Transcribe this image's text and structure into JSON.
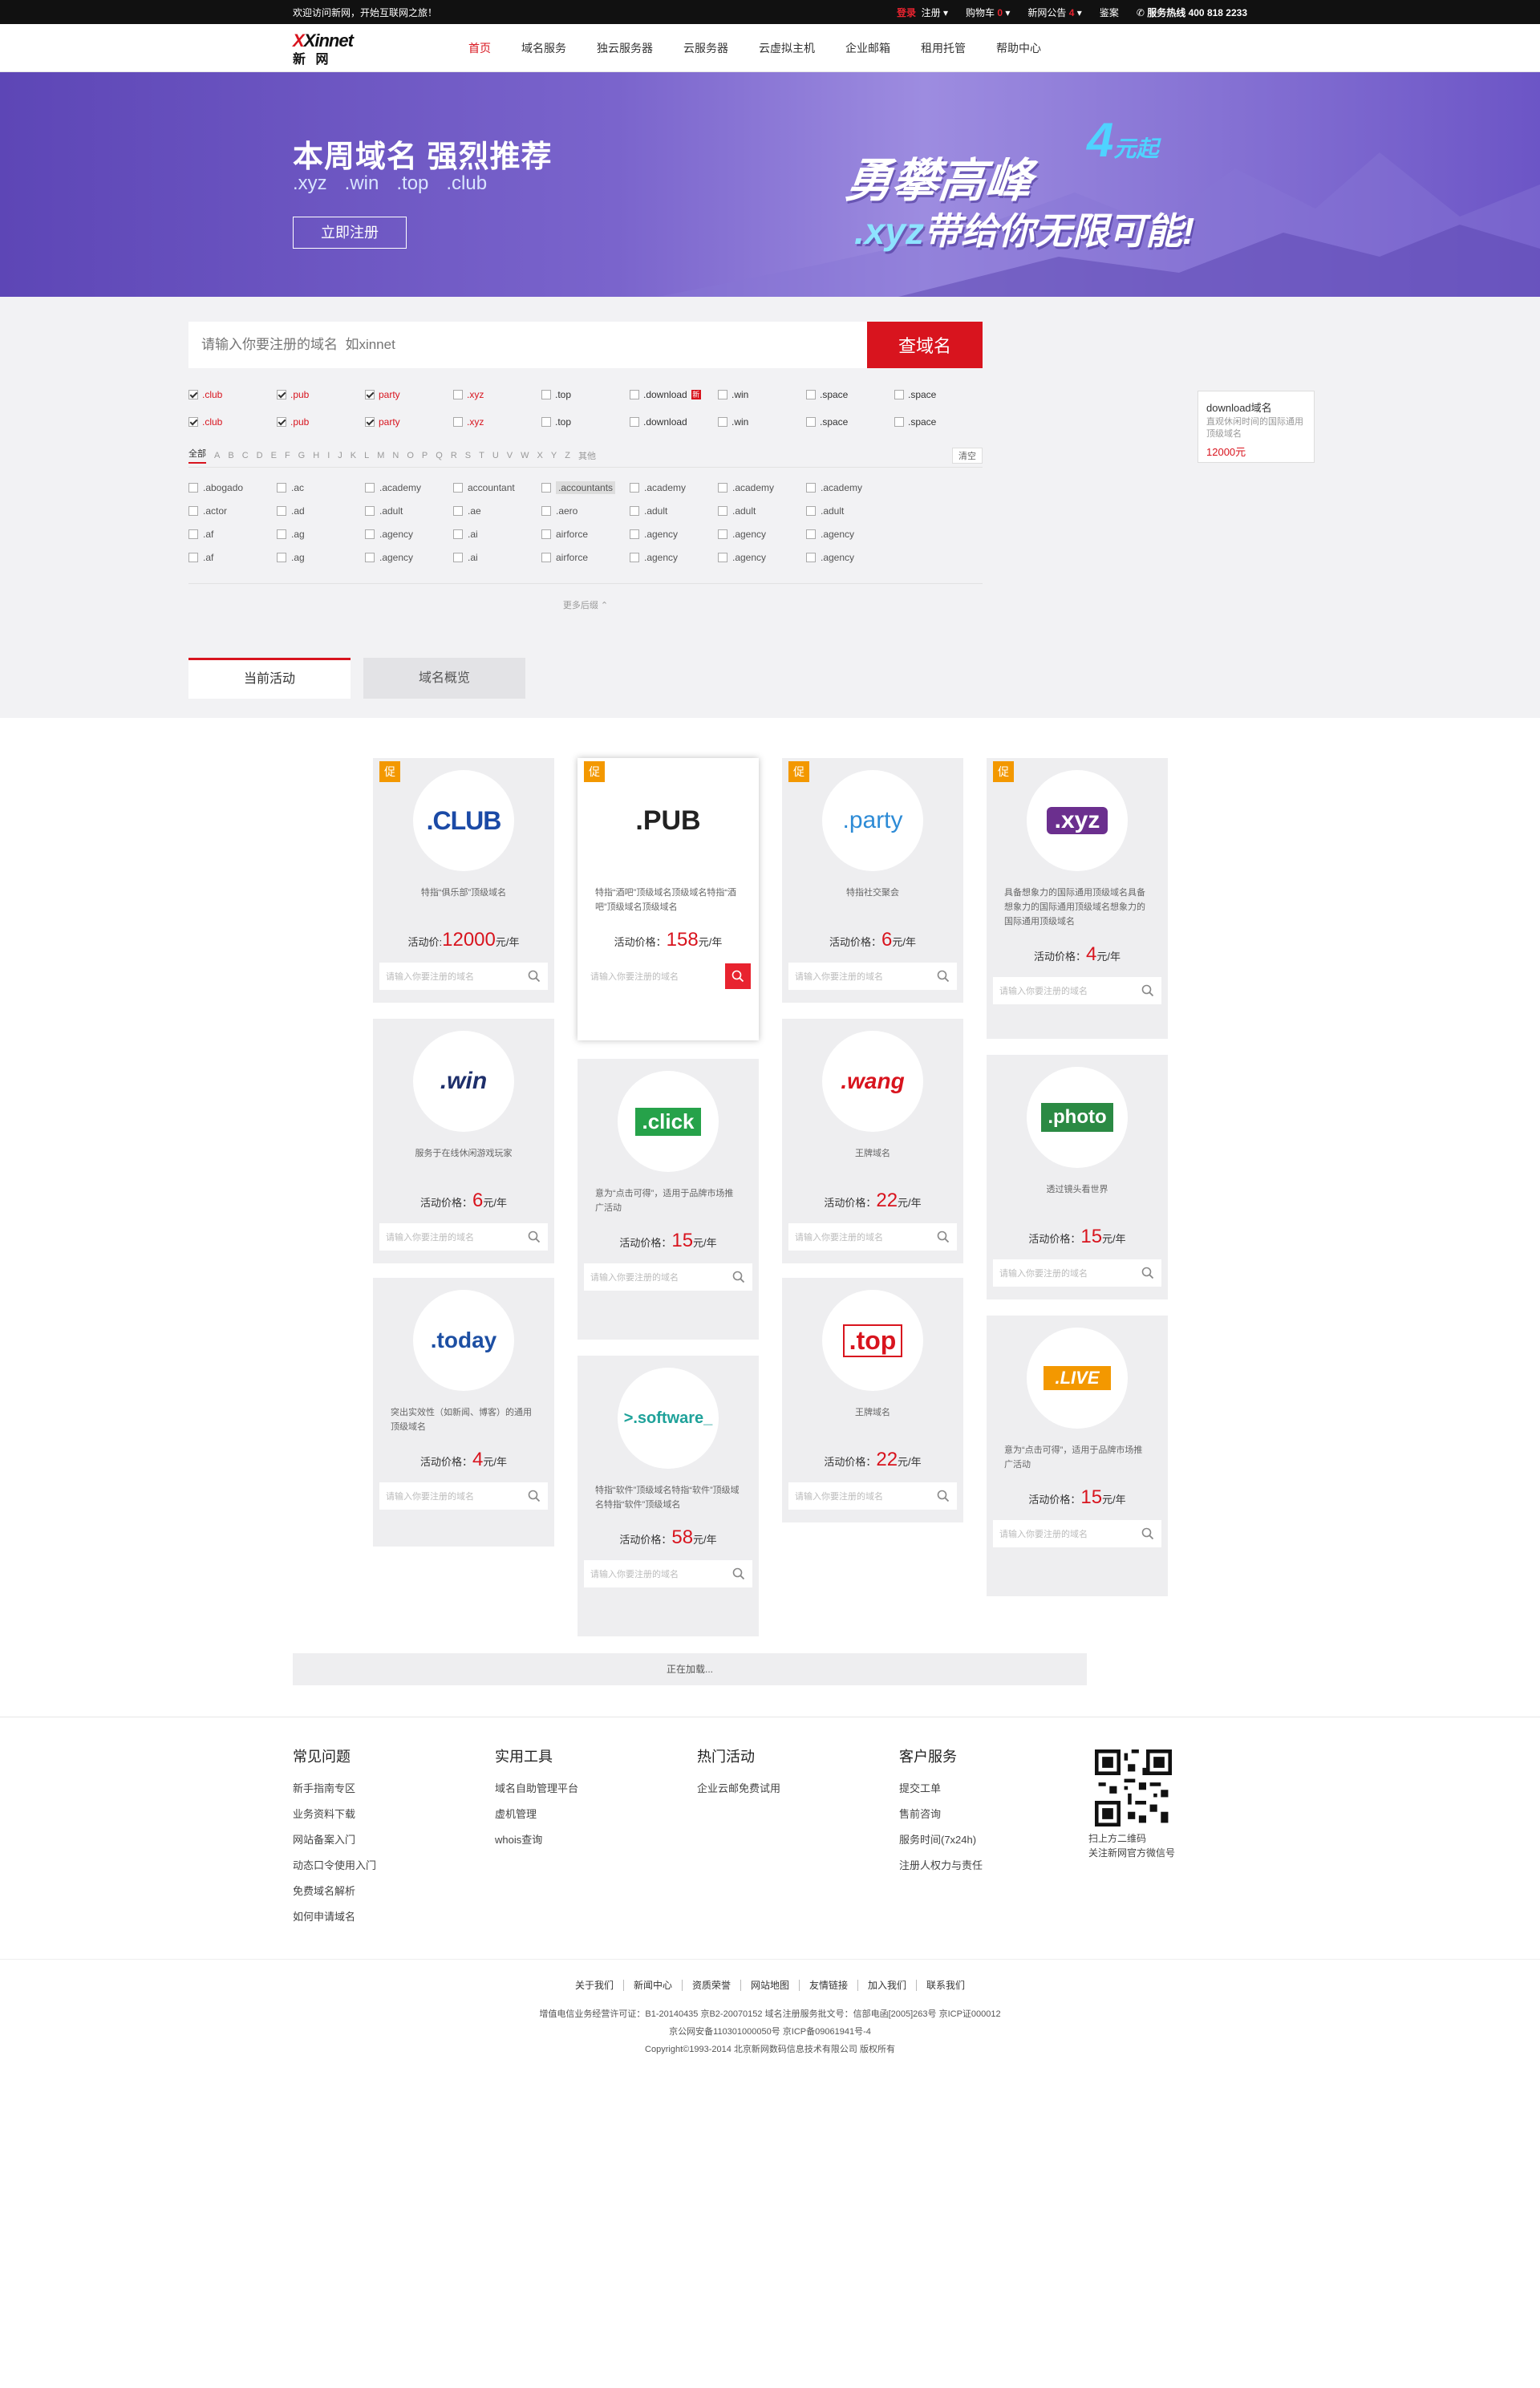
{
  "topbar": {
    "welcome": "欢迎访问新网，开始互联网之旅！",
    "login": "登录",
    "register": "注册",
    "cart": "购物车",
    "cart_count": "0",
    "notice": "新网公告",
    "notice_count": "4",
    "feedback": "鉴案",
    "hotline": "服务热线 400 818 2233"
  },
  "logo": {
    "en": "Xinnet",
    "cn": "新 网"
  },
  "nav": [
    "首页",
    "域名服务",
    "独云服务器",
    "云服务器",
    "云虚拟主机",
    "企业邮箱",
    "租用托管",
    "帮助中心"
  ],
  "banner": {
    "title": "本周域名 强烈推荐",
    "tlds": [
      ".xyz",
      ".win",
      ".top",
      ".club"
    ],
    "button": "立即注册",
    "slogan": "勇攀高峰",
    "four": "4",
    "yuan": "元起",
    "slogan2_a": ".xyz",
    "slogan2_b": "带给你无限可能!"
  },
  "search": {
    "placeholder": "请输入你要注册的域名  如xinnet",
    "button": "查域名"
  },
  "tld_rows": [
    [
      ".club",
      ".pub",
      "party",
      ".xyz",
      ".top",
      ".download",
      ".win",
      ".space",
      ".space"
    ],
    [
      ".club",
      ".pub",
      "party",
      ".xyz",
      ".top",
      ".download",
      ".win",
      ".space",
      ".space"
    ]
  ],
  "tip": {
    "title": "download域名",
    "desc": "直观休闲时间的国际通用顶级域名",
    "price": "12000元"
  },
  "alpha": {
    "all": "全部",
    "letters": [
      "A",
      "B",
      "C",
      "D",
      "E",
      "F",
      "G",
      "H",
      "I",
      "J",
      "K",
      "L",
      "M",
      "N",
      "O",
      "P",
      "Q",
      "R",
      "S",
      "T",
      "U",
      "V",
      "W",
      "X",
      "Y",
      "Z"
    ],
    "other": "其他",
    "clear": "清空"
  },
  "ext_rows": [
    [
      ".abogado",
      ".ac",
      ".academy",
      "accountant",
      ".accountants",
      ".academy",
      ".academy",
      ".academy"
    ],
    [
      ".actor",
      ".ad",
      ".adult",
      ".ae",
      ".aero",
      ".adult",
      ".adult",
      ".adult"
    ],
    [
      ".af",
      ".ag",
      ".agency",
      ".ai",
      "airforce",
      ".agency",
      ".agency",
      ".agency"
    ],
    [
      ".af",
      ".ag",
      ".agency",
      ".ai",
      "airforce",
      ".agency",
      ".agency",
      ".agency"
    ]
  ],
  "more": "更多后缀",
  "tabs": [
    "当前活动",
    "域名概览"
  ],
  "promo_label": "促",
  "search_small": "请输入你要注册的域名",
  "cards": [
    {
      "name": "CLUB",
      "logo": ".CLUB",
      "desc": "特指“俱乐部”顶级域名",
      "price_label": "活动价:",
      "price": "12000",
      "unit": "元/年"
    },
    {
      "name": "PUB",
      "logo": ".PUB",
      "desc": "特指“酒吧”顶级域名顶级域名特指“酒吧”顶级域名顶级域名",
      "price_label": "活动价格：",
      "price": "158",
      "unit": "元/年"
    },
    {
      "name": "party",
      "logo": ".party",
      "desc": "特指社交聚会",
      "price_label": "活动价格：",
      "price": "6",
      "unit": "元/年"
    },
    {
      "name": "xyz",
      "logo": ".xyz",
      "desc": "具备想象力的国际通用顶级域名具备想象力的国际通用顶级域名想象力的国际通用顶级域名",
      "price_label": "活动价格：",
      "price": "4",
      "unit": "元/年"
    },
    {
      "name": "win",
      "logo": ".win",
      "desc": "服务于在线休闲游戏玩家",
      "price_label": "活动价格：",
      "price": "6",
      "unit": "元/年"
    },
    {
      "name": "click",
      "logo": ".click",
      "desc": "意为“点击可得”，适用于品牌市场推广活动",
      "price_label": "活动价格：",
      "price": "15",
      "unit": "元/年"
    },
    {
      "name": "wang",
      "logo": ".wang",
      "desc": "王牌域名",
      "price_label": "活动价格：",
      "price": "22",
      "unit": "元/年"
    },
    {
      "name": "photo",
      "logo": ".photo",
      "desc": "透过镜头看世界",
      "price_label": "活动价格：",
      "price": "15",
      "unit": "元/年"
    },
    {
      "name": "today",
      "logo": ".today",
      "desc": "突出实效性（如新闻、博客）的通用顶级域名",
      "price_label": "活动价格：",
      "price": "4",
      "unit": "元/年"
    },
    {
      "name": "software",
      "logo": ">.software_",
      "desc": "特指“软件”顶级域名特指“软件”顶级域名特指“软件”顶级域名",
      "price_label": "活动价格：",
      "price": "58",
      "unit": "元/年"
    },
    {
      "name": "top",
      "logo": ".top",
      "desc": "王牌域名",
      "price_label": "活动价格：",
      "price": "22",
      "unit": "元/年"
    },
    {
      "name": "live",
      "logo": ".LIVE",
      "desc": "意为“点击可得”，适用于品牌市场推广活动",
      "price_label": "活动价格：",
      "price": "15",
      "unit": "元/年"
    }
  ],
  "loading": "正在加载...",
  "footer": {
    "cols": [
      {
        "title": "常见问题",
        "items": [
          "新手指南专区",
          "业务资料下载",
          "网站备案入门",
          "动态口令使用入门",
          "免费域名解析",
          "如何申请域名"
        ]
      },
      {
        "title": "实用工具",
        "items": [
          "域名自助管理平台",
          "虚机管理",
          "whois查询"
        ]
      },
      {
        "title": "热门活动",
        "items": [
          "企业云邮免费试用"
        ]
      },
      {
        "title": "客户服务",
        "items": [
          "提交工单",
          "售前咨询",
          "服务时间(7x24h)",
          "注册人权力与责任"
        ]
      }
    ],
    "qr_line1": "扫上方二维码",
    "qr_line2": "关注新网官方微信号",
    "links": [
      "关于我们",
      "新闻中心",
      "资质荣誉",
      "网站地图",
      "友情链接",
      "加入我们",
      "联系我们"
    ],
    "copy1": "增值电信业务经营许可证：B1-20140435 京B2-20070152 域名注册服务批文号：信部电函[2005]263号 京ICP证000012",
    "copy2": "京公网安备110301000050号 京ICP备09061941号-4",
    "copy3": "Copyright©1993-2014 北京新网数码信息技术有限公司 版权所有"
  },
  "colors": {
    "brand_red": "#d8141e",
    "banner_purple": "#6c55c6",
    "promo_orange": "#f39800"
  }
}
